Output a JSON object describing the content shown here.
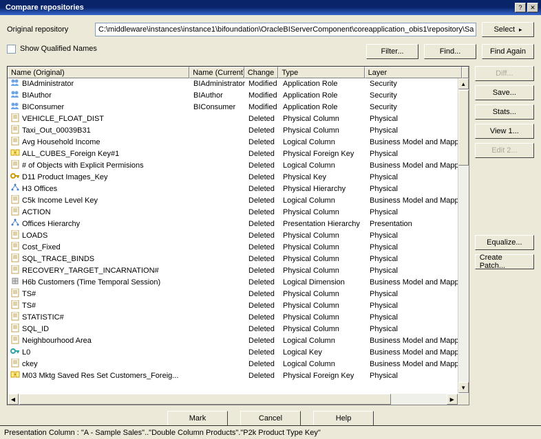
{
  "window": {
    "title": "Compare repositories"
  },
  "labels": {
    "original_repository": "Original repository",
    "show_qualified_names": "Show Qualified Names"
  },
  "path": "C:\\middleware\\instances\\instance1\\bifoundation\\OracleBIServerComponent\\coreapplication_obis1\\repository\\Sa",
  "buttons": {
    "select": "Select",
    "filter": "Filter...",
    "find": "Find...",
    "find_again": "Find Again",
    "diff": "Diff...",
    "save": "Save...",
    "stats": "Stats...",
    "view1": "View 1...",
    "edit2": "Edit 2...",
    "equalize": "Equalize...",
    "create_patch": "Create Patch...",
    "mark": "Mark",
    "cancel": "Cancel",
    "help": "Help"
  },
  "columns": {
    "name": "Name (Original)",
    "current": "Name (Current)",
    "change": "Change",
    "type": "Type",
    "layer": "Layer"
  },
  "rows": [
    {
      "icon": "role",
      "name": "BIAdministrator",
      "current": "BIAdministrator",
      "change": "Modified",
      "type": "Application Role",
      "layer": "Security"
    },
    {
      "icon": "role",
      "name": "BIAuthor",
      "current": "BIAuthor",
      "change": "Modified",
      "type": "Application Role",
      "layer": "Security"
    },
    {
      "icon": "role",
      "name": "BIConsumer",
      "current": "BIConsumer",
      "change": "Modified",
      "type": "Application Role",
      "layer": "Security"
    },
    {
      "icon": "col",
      "name": "VEHICLE_FLOAT_DIST",
      "current": "",
      "change": "Deleted",
      "type": "Physical Column",
      "layer": "Physical"
    },
    {
      "icon": "col",
      "name": "Taxi_Out_00039B31",
      "current": "",
      "change": "Deleted",
      "type": "Physical Column",
      "layer": "Physical"
    },
    {
      "icon": "col",
      "name": "Avg Household Income",
      "current": "",
      "change": "Deleted",
      "type": "Logical Column",
      "layer": "Business Model and Mapping"
    },
    {
      "icon": "fkey",
      "name": "ALL_CUBES_Foreign Key#1",
      "current": "",
      "change": "Deleted",
      "type": "Physical Foreign Key",
      "layer": "Physical"
    },
    {
      "icon": "col",
      "name": "# of Objects with Explicit Permisions",
      "current": "",
      "change": "Deleted",
      "type": "Logical Column",
      "layer": "Business Model and Mapping"
    },
    {
      "icon": "key",
      "name": "D11 Product Images_Key",
      "current": "",
      "change": "Deleted",
      "type": "Physical Key",
      "layer": "Physical"
    },
    {
      "icon": "hier",
      "name": "H3 Offices",
      "current": "",
      "change": "Deleted",
      "type": "Physical Hierarchy",
      "layer": "Physical"
    },
    {
      "icon": "col",
      "name": "C5k  Income Level Key",
      "current": "",
      "change": "Deleted",
      "type": "Logical Column",
      "layer": "Business Model and Mapping"
    },
    {
      "icon": "col",
      "name": "ACTION",
      "current": "",
      "change": "Deleted",
      "type": "Physical Column",
      "layer": "Physical"
    },
    {
      "icon": "hier",
      "name": "Offices Hierarchy",
      "current": "",
      "change": "Deleted",
      "type": "Presentation Hierarchy",
      "layer": "Presentation"
    },
    {
      "icon": "col",
      "name": "LOADS",
      "current": "",
      "change": "Deleted",
      "type": "Physical Column",
      "layer": "Physical"
    },
    {
      "icon": "col",
      "name": "Cost_Fixed",
      "current": "",
      "change": "Deleted",
      "type": "Physical Column",
      "layer": "Physical"
    },
    {
      "icon": "col",
      "name": "SQL_TRACE_BINDS",
      "current": "",
      "change": "Deleted",
      "type": "Physical Column",
      "layer": "Physical"
    },
    {
      "icon": "col",
      "name": "RECOVERY_TARGET_INCARNATION#",
      "current": "",
      "change": "Deleted",
      "type": "Physical Column",
      "layer": "Physical"
    },
    {
      "icon": "dim",
      "name": "H6b Customers (Time Temporal Session)",
      "current": "",
      "change": "Deleted",
      "type": "Logical Dimension",
      "layer": "Business Model and Mapping"
    },
    {
      "icon": "col",
      "name": "TS#",
      "current": "",
      "change": "Deleted",
      "type": "Physical Column",
      "layer": "Physical"
    },
    {
      "icon": "col",
      "name": "TS#",
      "current": "",
      "change": "Deleted",
      "type": "Physical Column",
      "layer": "Physical"
    },
    {
      "icon": "col",
      "name": "STATISTIC#",
      "current": "",
      "change": "Deleted",
      "type": "Physical Column",
      "layer": "Physical"
    },
    {
      "icon": "col",
      "name": "SQL_ID",
      "current": "",
      "change": "Deleted",
      "type": "Physical Column",
      "layer": "Physical"
    },
    {
      "icon": "col",
      "name": "Neighbourhood Area",
      "current": "",
      "change": "Deleted",
      "type": "Logical Column",
      "layer": "Business Model and Mapping"
    },
    {
      "icon": "lkey",
      "name": "L0",
      "current": "",
      "change": "Deleted",
      "type": "Logical Key",
      "layer": "Business Model and Mapping"
    },
    {
      "icon": "col",
      "name": "ckey",
      "current": "",
      "change": "Deleted",
      "type": "Logical Column",
      "layer": "Business Model and Mapping"
    },
    {
      "icon": "fkey",
      "name": "M03 Mktg Saved Res Set Customers_Foreig...",
      "current": "",
      "change": "Deleted",
      "type": "Physical Foreign Key",
      "layer": "Physical"
    }
  ],
  "status": "Presentation Column : \"A - Sample Sales\"..\"Double Column Products\".\"P2k  Product Type Key\""
}
